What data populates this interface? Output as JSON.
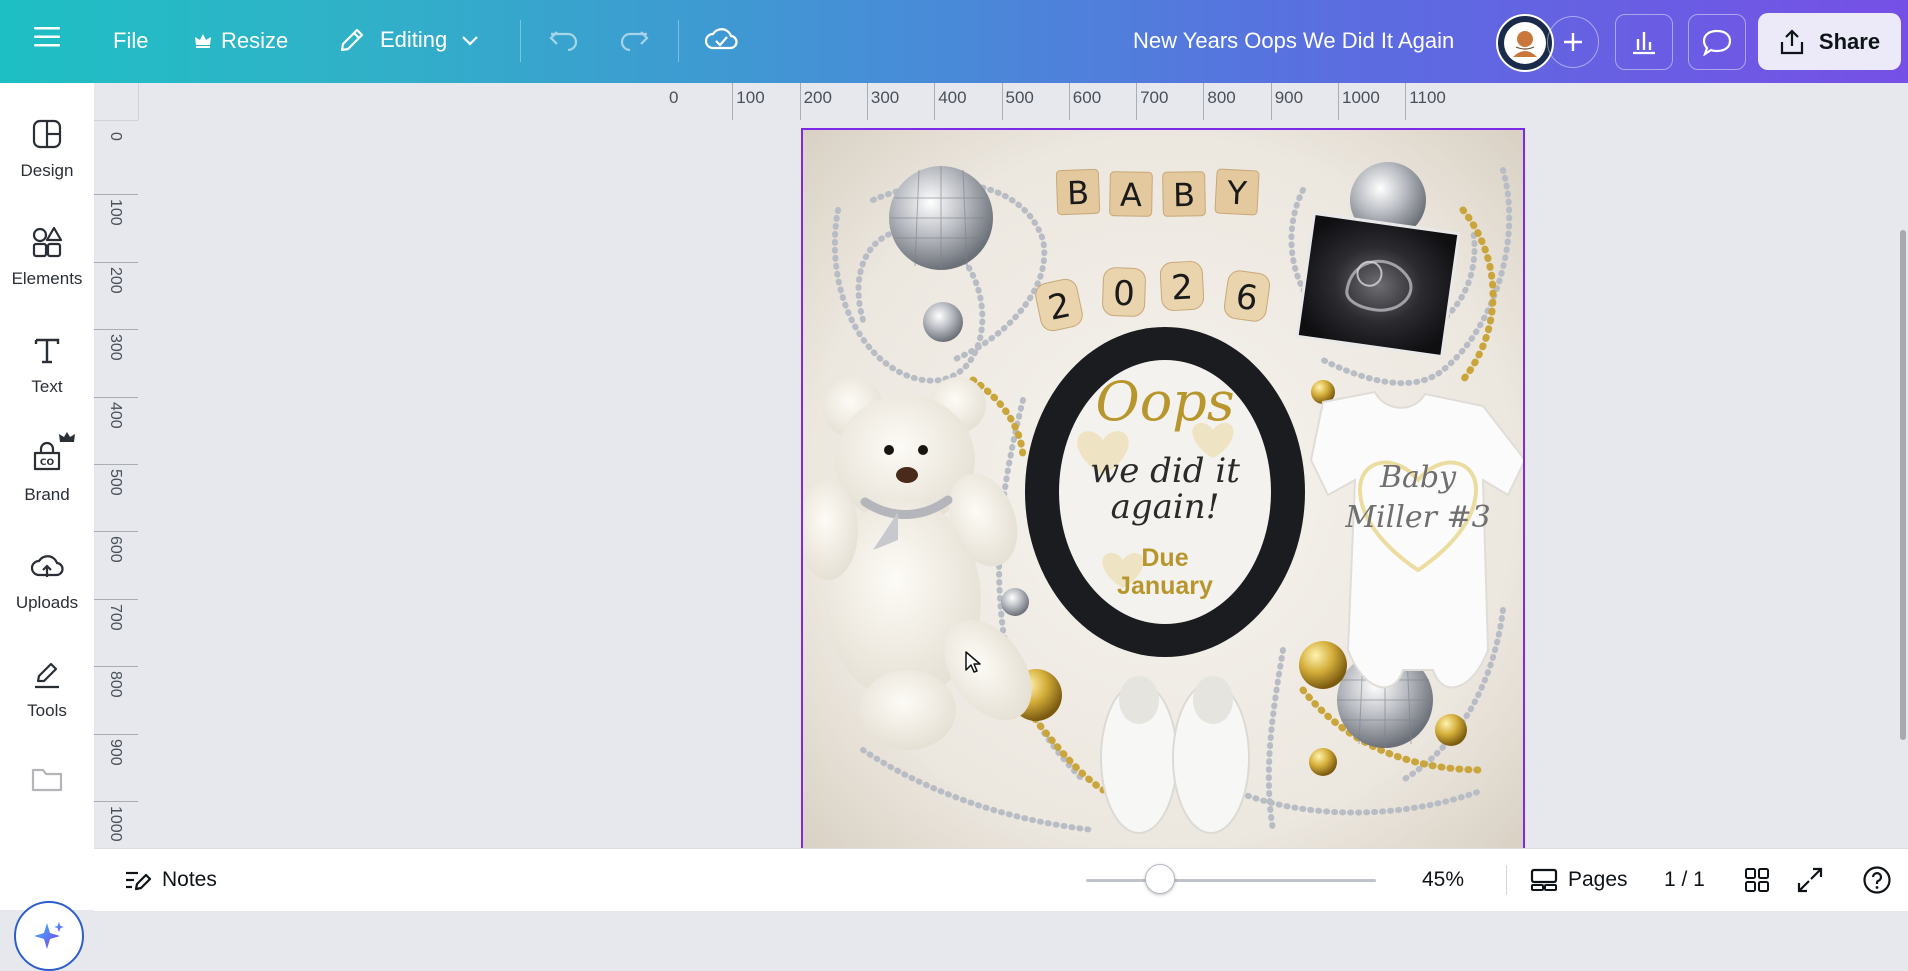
{
  "header": {
    "file_label": "File",
    "resize_label": "Resize",
    "editing_label": "Editing",
    "document_title": "New Years Oops We Did It Again",
    "share_label": "Share",
    "gradient_start": "#1ebfc4",
    "gradient_end": "#7650e6"
  },
  "sidebar": {
    "items": [
      {
        "label": "Design",
        "icon": "design-icon"
      },
      {
        "label": "Elements",
        "icon": "elements-icon"
      },
      {
        "label": "Text",
        "icon": "text-icon"
      },
      {
        "label": "Brand",
        "icon": "brand-icon"
      },
      {
        "label": "Uploads",
        "icon": "uploads-icon"
      },
      {
        "label": "Tools",
        "icon": "tools-icon"
      }
    ]
  },
  "rulers": {
    "horizontal": [
      "0",
      "100",
      "200",
      "300",
      "400",
      "500",
      "600",
      "700",
      "800",
      "900",
      "1000",
      "1100"
    ],
    "vertical": [
      "0",
      "100",
      "200",
      "300",
      "400",
      "500",
      "600",
      "700",
      "800",
      "900",
      "1000"
    ]
  },
  "design": {
    "tiles_word": [
      "B",
      "A",
      "B",
      "Y"
    ],
    "tiles_year": [
      "2",
      "0",
      "2",
      "6"
    ],
    "sign_line1": "Oops",
    "sign_line2": "we did it",
    "sign_line3": "again!",
    "sign_line4": "Due",
    "sign_line5": "January",
    "onesie_line1": "Baby",
    "onesie_line2": "Miller #3",
    "accent_gold": "#b8962e",
    "selection_color": "#7d2ae8"
  },
  "footer": {
    "notes_label": "Notes",
    "zoom_value": "45%",
    "zoom_fraction": 0.45,
    "pages_label": "Pages",
    "page_counter": "1 / 1"
  }
}
